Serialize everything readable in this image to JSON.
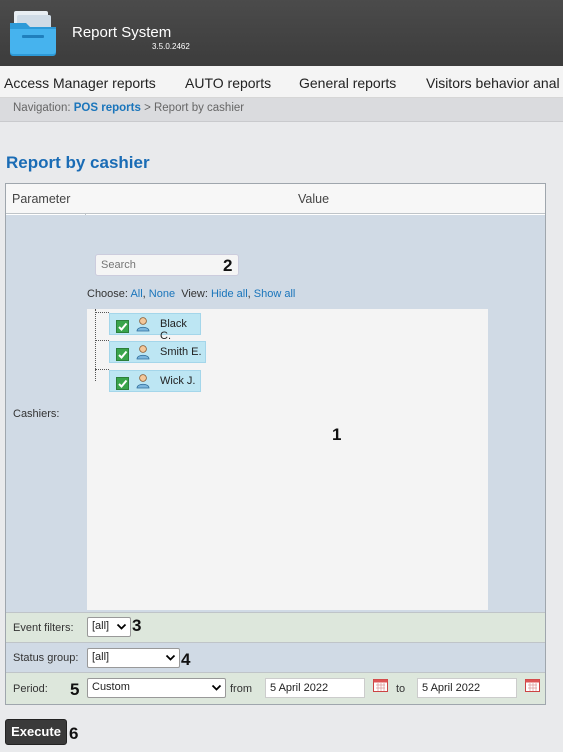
{
  "app": {
    "title": "Report System",
    "version": "3.5.0.2462"
  },
  "menu": [
    {
      "label": "Access Manager reports"
    },
    {
      "label": "AUTO reports"
    },
    {
      "label": "General reports"
    },
    {
      "label": "Visitors behavior anal"
    }
  ],
  "breadcrumb": {
    "prefix": "Navigation:",
    "link": "POS reports",
    "separator": ">",
    "current": "Report by cashier"
  },
  "page_title": "Report by cashier",
  "table": {
    "col_parameter": "Parameter",
    "col_value": "Value"
  },
  "cashiers": {
    "label": "Cashiers:",
    "search_placeholder": "Search",
    "choose_label": "Choose:",
    "choose_all": "All",
    "choose_none": "None",
    "view_label": "View:",
    "view_hide_all": "Hide all",
    "view_show_all": "Show all",
    "items": [
      {
        "name": "Black C.",
        "checked": true
      },
      {
        "name": "Smith E.",
        "checked": true
      },
      {
        "name": "Wick J.",
        "checked": true
      }
    ]
  },
  "event_filters": {
    "label": "Event filters:",
    "value": "[all]"
  },
  "status_group": {
    "label": "Status group:",
    "value": "[all]"
  },
  "period": {
    "label": "Period:",
    "value": "Custom",
    "from_label": "from",
    "from_date": "5 April 2022",
    "to_label": "to",
    "to_date": "5 April 2022"
  },
  "execute_label": "Execute",
  "callouts": [
    "1",
    "2",
    "3",
    "4",
    "5",
    "6"
  ],
  "colors": {
    "link": "#1a75bb",
    "title": "#1a6cb5",
    "header_bg": "#424242",
    "row_blue": "#d0dae5",
    "row_green": "#dde7dc"
  }
}
